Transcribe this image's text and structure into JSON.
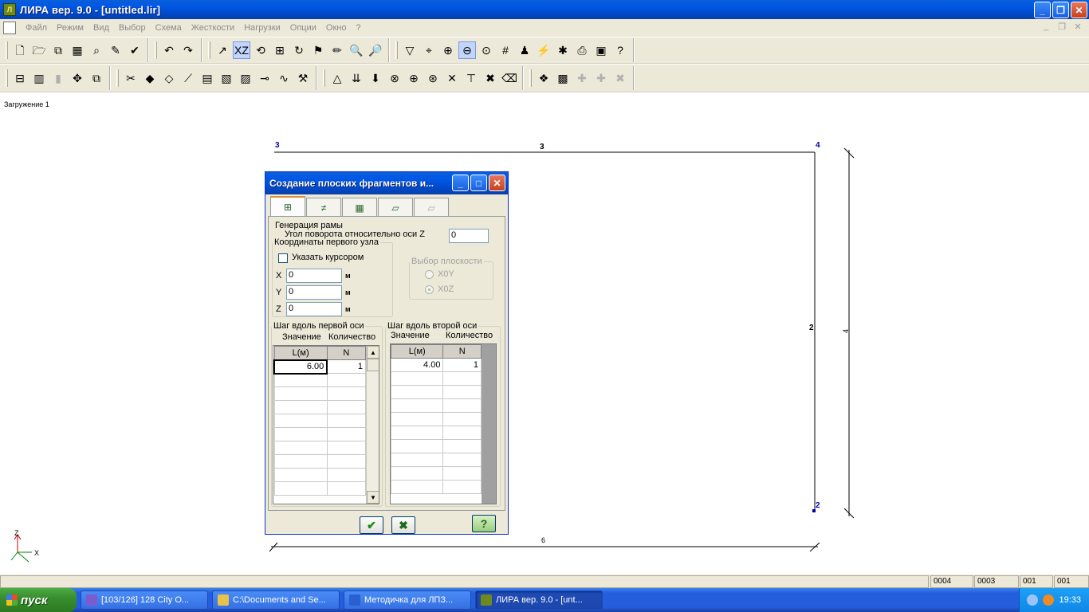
{
  "window": {
    "title": "ЛИРА  вер. 9.0 - [untitled.lir]",
    "app_icon_letter": "Л",
    "min": "_",
    "max": "❐",
    "close": "✕"
  },
  "menu": {
    "items": [
      "Файл",
      "Режим",
      "Вид",
      "Выбор",
      "Схема",
      "Жесткости",
      "Нагрузки",
      "Опции",
      "Окно",
      "?"
    ],
    "mdi": [
      "_",
      "❐",
      "✕"
    ]
  },
  "toolbar1": {
    "groups": [
      [
        "new-doc-icon",
        "open-doc-icon",
        "copy-doc-icon",
        "calc-icon",
        "find-icon",
        "edit-icon",
        "check-icon"
      ],
      [
        "undo-icon",
        "redo-icon"
      ],
      [
        "axes-icon",
        "xz-plane-icon",
        "rotate-plane-icon",
        "projection-icon",
        "refresh-icon",
        "flag-icon",
        "pencil-icon",
        "zoom-in-icon",
        "zoom-out-icon"
      ],
      [
        "filter-icon",
        "select-icon",
        "zoom-window-icon",
        "zoom-pan-icon",
        "zoom-fit-icon",
        "grid-icon",
        "marker-icon",
        "flash-icon",
        "person-icon",
        "print-icon",
        "save-icon",
        "help-pointer-icon"
      ]
    ],
    "glyphs": {
      "new-doc-icon": "🗋",
      "open-doc-icon": "🗁",
      "copy-doc-icon": "⧉",
      "calc-icon": "▦",
      "find-icon": "⌕",
      "edit-icon": "✎",
      "check-icon": "✔",
      "undo-icon": "↶",
      "redo-icon": "↷",
      "axes-icon": "↗",
      "xz-plane-icon": "XZ",
      "rotate-plane-icon": "⟲",
      "projection-icon": "⊞",
      "refresh-icon": "↻",
      "flag-icon": "⚑",
      "pencil-icon": "✏",
      "zoom-in-icon": "🔍",
      "zoom-out-icon": "🔎",
      "filter-icon": "▽",
      "select-icon": "⌖",
      "zoom-window-icon": "⊕",
      "zoom-pan-icon": "⊖",
      "zoom-fit-icon": "⊙",
      "grid-icon": "#",
      "marker-icon": "♟",
      "flash-icon": "⚡",
      "person-icon": "✱",
      "print-icon": "⎙",
      "save-icon": "▣",
      "help-pointer-icon": "?"
    }
  },
  "toolbar2": {
    "groups": [
      [
        "frame-icon",
        "bars-icon",
        "cylinder-icon",
        "move-icon",
        "copy-icon"
      ],
      [
        "cut-icon",
        "node-icon",
        "add-node-icon",
        "add-bar-icon",
        "stiffness-icon",
        "section-icon",
        "material-icon",
        "hinge-icon",
        "link-icon",
        "spanner-icon"
      ],
      [
        "support-icon",
        "load-icon",
        "load-node-icon",
        "load-bar-icon",
        "load-plate-icon",
        "load-group-icon",
        "cross-icon",
        "t-icon",
        "x-icon",
        "del-icon"
      ],
      [
        "assemble-icon",
        "duplicate-icon",
        "merge-icon",
        "split-icon",
        "erase-icon"
      ]
    ],
    "disabled": [
      "cylinder-icon",
      "merge-icon",
      "split-icon",
      "erase-icon"
    ],
    "glyphs": {
      "frame-icon": "⊟",
      "bars-icon": "▥",
      "cylinder-icon": "▮",
      "move-icon": "✥",
      "copy-icon": "⧉",
      "cut-icon": "✂",
      "node-icon": "◆",
      "add-node-icon": "◇",
      "add-bar-icon": "⟋",
      "stiffness-icon": "▤",
      "section-icon": "▧",
      "material-icon": "▨",
      "hinge-icon": "⊸",
      "link-icon": "∿",
      "spanner-icon": "⚒",
      "support-icon": "△",
      "load-icon": "⇊",
      "load-node-icon": "⬇",
      "load-bar-icon": "⊗",
      "load-plate-icon": "⊕",
      "load-group-icon": "⊛",
      "cross-icon": "✕",
      "t-icon": "⊤",
      "x-icon": "✖",
      "del-icon": "⌫",
      "assemble-icon": "❖",
      "duplicate-icon": "▩",
      "merge-icon": "✚",
      "split-icon": "✚",
      "erase-icon": "✖"
    }
  },
  "canvas": {
    "load_case": "Загружение  1",
    "nodes": {
      "top_left": "3",
      "top_right": "4",
      "bottom_right": "2"
    },
    "bars": {
      "top": "3",
      "right": "2"
    },
    "dimensions": {
      "horizontal": "6",
      "vertical": "4"
    },
    "axes": {
      "z": "Z",
      "x": "X"
    }
  },
  "dialog": {
    "title": "Создание плоских фрагментов и...",
    "tabs": [
      {
        "icon": "frame-tab-icon",
        "glyph": "⊞",
        "active": true
      },
      {
        "icon": "beam-tab-icon",
        "glyph": "≠",
        "active": false
      },
      {
        "icon": "plate-tab-icon",
        "glyph": "▦",
        "active": false
      },
      {
        "icon": "slab-tab-icon",
        "glyph": "⏥",
        "active": false
      },
      {
        "icon": "shell-tab-icon",
        "glyph": "⏥",
        "active": false,
        "disabled": true
      }
    ],
    "generation_group": "Генерация  рамы",
    "rotation_label": "Угол поворота относительно оси Z",
    "rotation_value": "0",
    "first_node_group": "Координаты первого узла",
    "cursor_checkbox": "Указать курсором",
    "coords": [
      {
        "axis": "X",
        "value": "0",
        "unit": "м"
      },
      {
        "axis": "Y",
        "value": "0",
        "unit": "м"
      },
      {
        "axis": "Z",
        "value": "0",
        "unit": "м"
      }
    ],
    "plane_group": "Выбор плоскости",
    "plane_options": [
      {
        "label": "X0Y",
        "selected": false
      },
      {
        "label": "X0Z",
        "selected": true
      }
    ],
    "step1": {
      "legend": "Шаг вдоль первой оси",
      "col_value": "Значение",
      "col_count": "Количество",
      "headers": [
        "L(м)",
        "N"
      ],
      "rows": [
        [
          "6.00",
          "1"
        ]
      ]
    },
    "step2": {
      "legend": "Шаг вдоль второй оси",
      "col_value": "Значение",
      "col_count": "Количество",
      "headers": [
        "L(м)",
        "N"
      ],
      "rows": [
        [
          "4.00",
          "1"
        ]
      ]
    },
    "buttons": {
      "apply": "✔",
      "cancel": "✖",
      "help": "?"
    }
  },
  "status": {
    "cells": [
      "0004",
      "0003",
      "001",
      "001"
    ]
  },
  "taskbar": {
    "start": "пуск",
    "tasks": [
      {
        "label": "[103/126] 128 City O...",
        "color": "#7a5ccf",
        "active": false
      },
      {
        "label": "C:\\Documents and Se...",
        "color": "#e8c24a",
        "active": false
      },
      {
        "label": "Методичка для ЛПЗ...",
        "color": "#2a5fd0",
        "active": false
      },
      {
        "label": "ЛИРА  вер. 9.0 - [unt...",
        "color": "#6c8a1e",
        "active": true
      }
    ],
    "clock": "19:33"
  }
}
